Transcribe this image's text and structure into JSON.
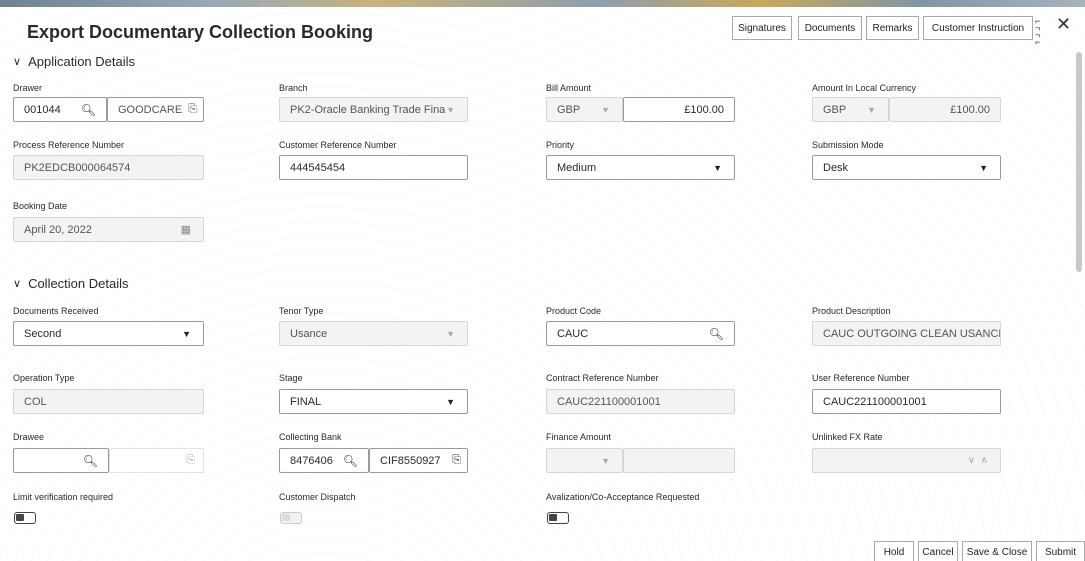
{
  "title": "Export Documentary Collection Booking",
  "header_buttons": [
    "Signatures",
    "Documents",
    "Remarks",
    "Customer Instruction"
  ],
  "sections": {
    "application": "Application Details",
    "collection": "Collection Details"
  },
  "application": {
    "drawer": {
      "label": "Drawer",
      "id": "001044",
      "name": "GOODCARE"
    },
    "branch": {
      "label": "Branch",
      "value": "PK2-Oracle Banking Trade Fina"
    },
    "bill_amount": {
      "label": "Bill Amount",
      "currency": "GBP",
      "amount": "£100.00"
    },
    "local_amount": {
      "label": "Amount In Local Currency",
      "currency": "GBP",
      "amount": "£100.00"
    },
    "process_ref": {
      "label": "Process Reference Number",
      "value": "PK2EDCB000064574"
    },
    "customer_ref": {
      "label": "Customer Reference Number",
      "value": "444545454"
    },
    "priority": {
      "label": "Priority",
      "value": "Medium"
    },
    "submission_mode": {
      "label": "Submission Mode",
      "value": "Desk"
    },
    "booking_date": {
      "label": "Booking Date",
      "value": "April 20, 2022"
    }
  },
  "collection": {
    "documents_received": {
      "label": "Documents Received",
      "value": "Second"
    },
    "tenor_type": {
      "label": "Tenor Type",
      "value": "Usance"
    },
    "product_code": {
      "label": "Product Code",
      "value": "CAUC"
    },
    "product_description": {
      "label": "Product Description",
      "value": "CAUC OUTGOING CLEAN USANCE"
    },
    "operation_type": {
      "label": "Operation Type",
      "value": "COL"
    },
    "stage": {
      "label": "Stage",
      "value": "FINAL"
    },
    "contract_ref": {
      "label": "Contract Reference Number",
      "value": "CAUC221100001001"
    },
    "user_ref": {
      "label": "User Reference Number",
      "value": "CAUC221100001001"
    },
    "drawee": {
      "label": "Drawee",
      "value": ""
    },
    "collecting_bank": {
      "label": "Collecting Bank",
      "id": "8476406",
      "name": "CIF8550927"
    },
    "finance_amount": {
      "label": "Finance Amount"
    },
    "unlinked_fx": {
      "label": "Unlinked FX Rate"
    },
    "limit_verification": {
      "label": "Limit verification required"
    },
    "customer_dispatch": {
      "label": "Customer Dispatch"
    },
    "avalization": {
      "label": "Avalization/Co-Acceptance Requested"
    }
  },
  "footer_buttons": [
    "Hold",
    "Cancel",
    "Save & Close",
    "Submit"
  ]
}
